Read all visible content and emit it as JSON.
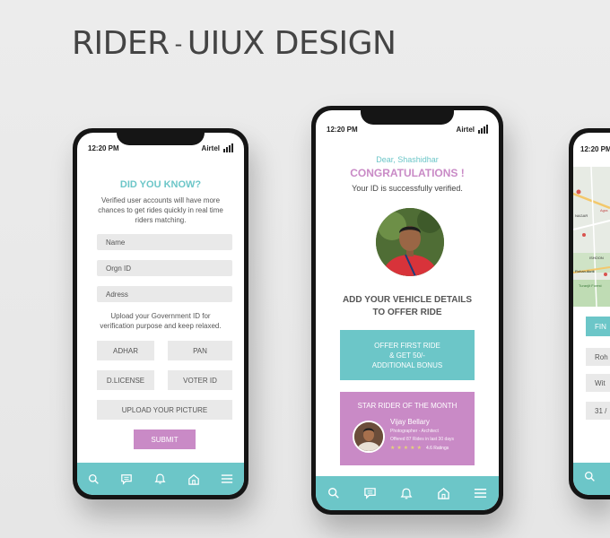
{
  "headline": {
    "part1": "RIDER",
    "dash": "-",
    "part2": "UIUX DESIGN"
  },
  "phone1": {
    "time": "12:20 PM",
    "carrier": "Airtel",
    "title": "DID YOU KNOW?",
    "info": "Verified user accounts will have more chances to get rides quickly in real time riders matching.",
    "fields": {
      "name": "Name",
      "orgn_id": "Orgn ID",
      "address": "Adress"
    },
    "upload_info": "Upload your Government ID for verification purpose and keep relaxed.",
    "docs": {
      "adhar": "ADHAR",
      "pan": "PAN",
      "dlicense": "D.LICENSE",
      "voter_id": "VOTER ID"
    },
    "upload_picture": "UPLOAD YOUR PICTURE",
    "submit": "SUBMIT"
  },
  "phone2": {
    "time": "12:20 PM",
    "carrier": "Airtel",
    "greeting": "Dear, Shashidhar",
    "congrats": "CONGRATULATIONS !",
    "verified": "Your  ID is successfully verified.",
    "vehicle_line1": "ADD YOUR VEHICLE DETAILS",
    "vehicle_line2": "TO OFFER RIDE",
    "offer_line1": "OFFER FIRST RIDE",
    "offer_line2": "& GET 50/-",
    "offer_line3": "ADDITIONAL BONUS",
    "star_title": "STAR RIDER OF THE MONTH",
    "star_name": "Vijay Bellary",
    "star_role": "Photographer - Architect",
    "star_offered": "Offered 87 Rides  in last 30 days",
    "star_rating": "4.6 Ratings"
  },
  "phone3": {
    "time": "12:20 PM",
    "map_labels": {
      "rohan": "Rohan Akriti",
      "ishoon": "ISHOON",
      "agra": "Agra",
      "turanjit": "Turanjit Forest",
      "nagar": "NAGAR"
    },
    "find_button": "FIN",
    "row1": "Roh",
    "row2": "Wit",
    "row3": "31 /"
  },
  "colors": {
    "teal": "#6cc6c8",
    "pink": "#c98ac6",
    "field_gray": "#e9e9e9"
  }
}
